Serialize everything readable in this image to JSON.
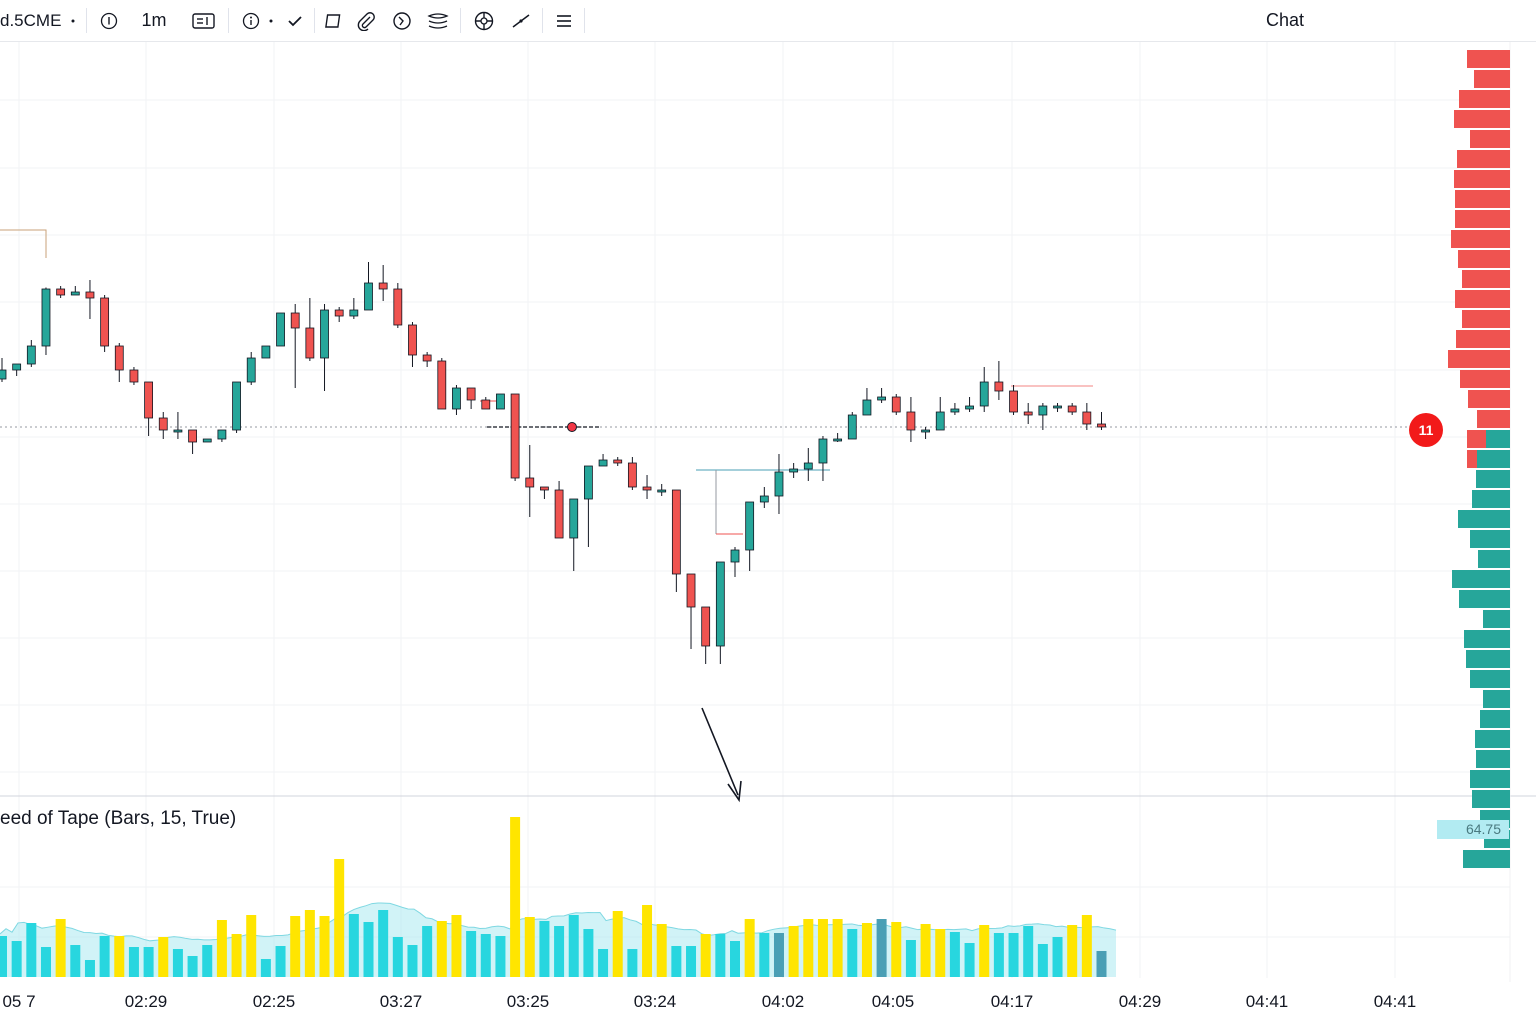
{
  "toolbar": {
    "symbol": "d.5CME",
    "interval": "1m",
    "items": [
      "dot-menu",
      "info-icon",
      "interval",
      "bar-style-icon",
      "indicator-info-icon",
      "checkmark-icon",
      "rectangle-icon",
      "paperclip-icon",
      "timer-icon",
      "layers-icon",
      "crosshair-icon",
      "line-tool-icon",
      "menu-icon"
    ]
  },
  "chat": {
    "title": "Chat"
  },
  "indicator": {
    "label": "eed of Tape (Bars, 15, True)",
    "value": "64.75"
  },
  "current_price_badge": "11",
  "colors": {
    "up": "#26a69a",
    "down": "#ef5350",
    "osc_yellow": "#ffe500",
    "osc_cyan": "#28d6df",
    "osc_dark": "#4a9fb5",
    "avg_fill": "#b2ebf2"
  },
  "x_axis_ticks": [
    "05 7",
    "02:29",
    "02:25",
    "03:27",
    "03:25",
    "03:24",
    "04:02",
    "04:05",
    "04:17",
    "04:29",
    "04:41",
    "04:41"
  ],
  "chart_data": {
    "type": "candlestick",
    "timeframe": "1m",
    "price_scale_visible": false,
    "candles": [
      [
        1.6,
        1.9,
        2.3,
        1.5
      ],
      [
        1.9,
        2.1,
        2.1,
        1.7
      ],
      [
        2.1,
        2.7,
        2.9,
        2.0
      ],
      [
        2.7,
        4.6,
        4.65,
        2.4
      ],
      [
        4.6,
        4.4,
        4.7,
        4.3
      ],
      [
        4.4,
        4.5,
        4.7,
        4.4
      ],
      [
        4.5,
        4.3,
        4.9,
        3.6
      ],
      [
        4.3,
        2.7,
        4.4,
        2.5
      ],
      [
        2.7,
        1.9,
        2.8,
        1.5
      ],
      [
        1.9,
        1.5,
        2.0,
        1.4
      ],
      [
        1.5,
        0.3,
        1.5,
        -0.3
      ],
      [
        0.3,
        -0.1,
        0.5,
        -0.4
      ],
      [
        -0.1,
        -0.1,
        0.5,
        -0.4
      ],
      [
        -0.1,
        -0.5,
        -0.2,
        -0.9
      ],
      [
        -0.5,
        -0.4,
        -0.4,
        -0.5
      ],
      [
        -0.4,
        -0.1,
        -0.1,
        -0.5
      ],
      [
        -0.1,
        1.5,
        1.5,
        -0.2
      ],
      [
        1.5,
        2.3,
        2.5,
        1.4
      ],
      [
        2.3,
        2.7,
        2.7,
        2.3
      ],
      [
        2.7,
        3.8,
        3.8,
        2.7
      ],
      [
        3.8,
        3.3,
        4.1,
        1.3
      ],
      [
        3.3,
        2.3,
        4.3,
        2.2
      ],
      [
        2.3,
        3.9,
        4.1,
        1.2
      ],
      [
        3.9,
        3.7,
        4.0,
        3.5
      ],
      [
        3.7,
        3.9,
        4.3,
        3.6
      ],
      [
        3.9,
        4.8,
        5.5,
        4.4
      ],
      [
        4.8,
        4.6,
        5.4,
        4.2
      ],
      [
        4.6,
        3.4,
        4.8,
        3.3
      ],
      [
        3.4,
        2.4,
        3.5,
        2.0
      ],
      [
        2.4,
        2.2,
        2.5,
        2.0
      ],
      [
        2.2,
        0.6,
        2.3,
        0.6
      ],
      [
        0.6,
        1.3,
        1.4,
        0.4
      ],
      [
        1.3,
        0.9,
        1.3,
        0.6
      ],
      [
        0.9,
        0.6,
        1.0,
        0.6
      ],
      [
        0.6,
        1.1,
        1.1,
        0.8
      ],
      [
        1.1,
        -1.7,
        -1.7,
        -1.8
      ],
      [
        -1.7,
        -2.0,
        -0.6,
        -3.0
      ],
      [
        -2.0,
        -2.1,
        -2.0,
        -2.4
      ],
      [
        -2.1,
        -3.7,
        -1.8,
        -3.7
      ],
      [
        -3.7,
        -2.4,
        -2.4,
        -4.8
      ],
      [
        -2.4,
        -1.3,
        -1.3,
        -4.0
      ],
      [
        -1.3,
        -1.1,
        -0.9,
        -1.3
      ],
      [
        -1.1,
        -1.2,
        -1.0,
        -1.3
      ],
      [
        -1.2,
        -2.0,
        -1.0,
        -2.1
      ],
      [
        -2.0,
        -2.1,
        -1.6,
        -2.4
      ],
      [
        -2.1,
        -2.1,
        -1.9,
        -2.3
      ],
      [
        -2.1,
        -4.9,
        -4.3,
        -5.5
      ],
      [
        -4.9,
        -6.0,
        -5.4,
        -7.4
      ],
      [
        -6.0,
        -7.3,
        -7.1,
        -7.9
      ],
      [
        -7.3,
        -4.5,
        -4.5,
        -7.9
      ],
      [
        -4.5,
        -4.1,
        -4.0,
        -5.0
      ],
      [
        -4.1,
        -2.5,
        -2.5,
        -4.8
      ],
      [
        -2.5,
        -2.3,
        -2.0,
        -2.7
      ],
      [
        -2.3,
        -1.5,
        -0.9,
        -2.9
      ],
      [
        -1.5,
        -1.4,
        -1.2,
        -1.7
      ],
      [
        -1.4,
        -1.2,
        -0.7,
        -1.8
      ],
      [
        -1.2,
        -0.4,
        -0.3,
        -1.8
      ],
      [
        -0.4,
        -0.4,
        -0.2,
        -0.5
      ],
      [
        -0.4,
        0.4,
        0.5,
        -0.4
      ],
      [
        0.4,
        0.9,
        1.3,
        0.4
      ],
      [
        0.9,
        1.0,
        1.3,
        0.8
      ],
      [
        1.0,
        0.5,
        1.1,
        0.4
      ],
      [
        0.5,
        -0.1,
        1.0,
        -0.5
      ],
      [
        -0.1,
        -0.1,
        0.0,
        -0.4
      ],
      [
        -0.1,
        0.5,
        1.0,
        -0.1
      ],
      [
        0.5,
        0.6,
        0.8,
        0.4
      ],
      [
        0.6,
        0.7,
        1.0,
        0.5
      ],
      [
        0.7,
        1.5,
        2.0,
        0.5
      ],
      [
        1.5,
        1.2,
        2.2,
        0.9
      ],
      [
        1.2,
        0.5,
        1.4,
        0.4
      ],
      [
        0.5,
        0.4,
        0.8,
        0.1
      ],
      [
        0.4,
        0.7,
        0.8,
        -0.1
      ],
      [
        0.7,
        0.7,
        0.8,
        0.5
      ],
      [
        0.7,
        0.5,
        0.8,
        0.4
      ],
      [
        0.5,
        0.1,
        0.8,
        -0.1
      ],
      [
        0.1,
        0.0,
        0.5,
        -0.1
      ]
    ],
    "current_price_level": 0.0,
    "volume_profile": {
      "sell": [
        0.43,
        0.36,
        0.51,
        0.56,
        0.4,
        0.53,
        0.56,
        0.55,
        0.55,
        0.59,
        0.52,
        0.48,
        0.55,
        0.48,
        0.54,
        0.62,
        0.5,
        0.42,
        0.33,
        0.43,
        0.43,
        0.2
      ],
      "buy": [
        0.24,
        0.33,
        0.34,
        0.38,
        0.52,
        0.4,
        0.32,
        0.58,
        0.51,
        0.27,
        0.46,
        0.44,
        0.4,
        0.27,
        0.3,
        0.35,
        0.34,
        0.4,
        0.38,
        0.3,
        0.26,
        0.47
      ]
    },
    "speed_of_tape": {
      "length": 15,
      "last_value": 64.75,
      "bars": [
        41,
        51,
        36,
        78,
        54,
        41,
        41,
        30,
        55,
        58,
        54,
        31,
        32,
        17,
        17,
        39,
        38,
        41,
        49,
        41,
        32,
        53,
        30,
        33,
        30,
        34,
        39,
        40,
        50,
        28,
        30,
        21,
        28,
        50,
        32,
        33,
        57,
        43,
        42,
        43,
        42,
        62,
        40,
        39,
        18,
        32,
        31,
        29,
        59,
        61,
        58,
        67,
        60,
        57,
        61,
        113,
        118,
        57,
        99,
        63,
        62,
        55,
        59,
        67,
        60,
        54,
        40,
        32,
        32,
        59,
        56,
        51,
        43,
        56,
        44,
        53,
        62,
        25,
        46,
        58,
        36,
        43,
        54,
        41,
        50,
        25,
        160,
        78,
        60,
        32,
        59,
        56,
        69,
        51,
        60,
        62,
        60,
        51,
        48,
        48,
        28,
        44,
        99,
        66,
        47,
        28,
        35,
        24,
        72,
        32,
        53,
        43,
        38,
        31,
        36,
        31,
        36,
        44,
        43,
        57,
        43,
        40,
        62,
        36,
        38,
        58,
        33,
        44,
        62,
        56,
        44,
        42,
        51,
        59,
        67,
        58,
        30,
        58,
        46,
        41,
        58,
        38,
        48,
        44,
        49,
        54,
        53,
        58,
        30,
        43,
        55,
        42,
        37,
        26,
        52,
        53,
        31,
        48,
        49,
        45,
        60,
        58,
        34,
        55,
        52,
        50,
        45,
        44,
        56,
        44,
        60,
        52,
        51,
        54,
        33,
        55,
        35,
        40,
        39,
        52,
        48,
        35,
        62,
        59,
        26,
        48,
        33
      ]
    }
  }
}
